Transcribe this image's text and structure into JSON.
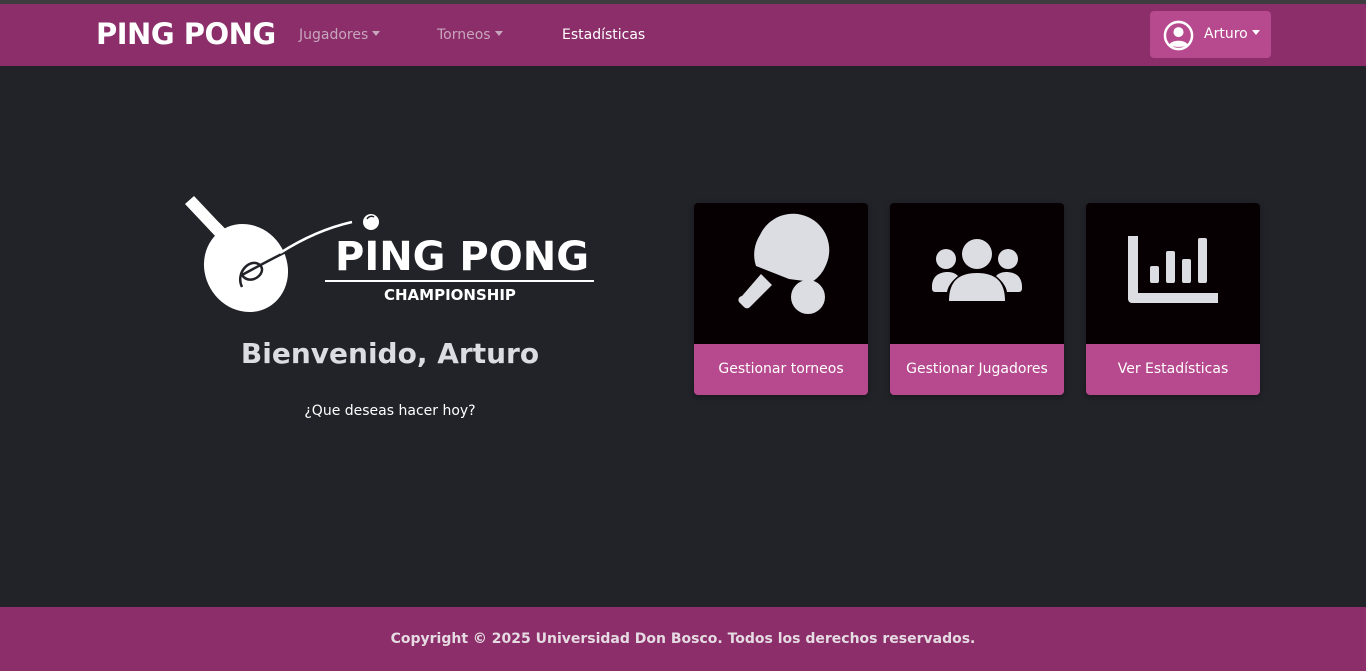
{
  "navbar": {
    "brand": "PING PONG",
    "links": [
      {
        "label": "Jugadores",
        "dropdown": true
      },
      {
        "label": "Torneos",
        "dropdown": true
      },
      {
        "label": "Estadísticas",
        "dropdown": false
      }
    ],
    "user": {
      "name": "Arturo",
      "icon": "user-circle-icon"
    }
  },
  "hero": {
    "logo_text": "PING PONG",
    "logo_subtext": "CHAMPIONSHIP",
    "welcome": "Bienvenido, Arturo",
    "subtitle": "¿Que deseas hacer hoy?"
  },
  "cards": [
    {
      "label": "Gestionar torneos",
      "icon": "ping-pong-paddle-icon"
    },
    {
      "label": "Gestionar Jugadores",
      "icon": "users-group-icon"
    },
    {
      "label": "Ver Estadísticas",
      "icon": "bar-chart-icon"
    }
  ],
  "footer": {
    "copyright": "Copyright © 2025 Universidad Don Bosco. Todos los derechos reservados."
  },
  "colors": {
    "navbar": "#8b2e6a",
    "accent": "#b7498e",
    "background": "#212328",
    "card_top": "#060002"
  }
}
